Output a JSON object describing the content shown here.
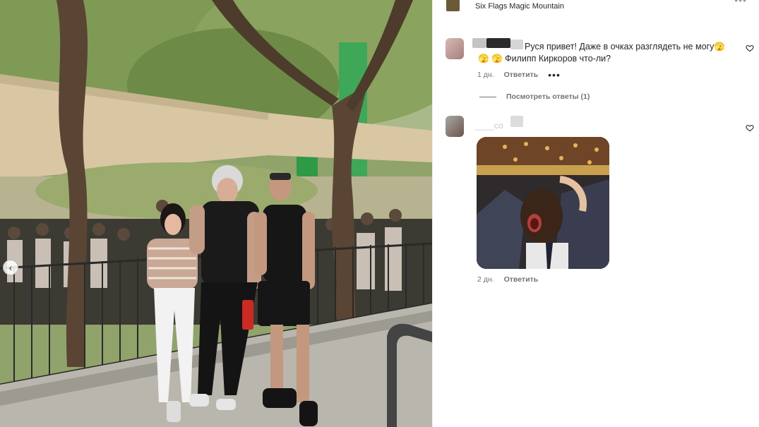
{
  "post": {
    "location": "Six Flags Magic Mountain",
    "more_icon": "more-horizontal-icon"
  },
  "carousel": {
    "prev_icon": "chevron-left-icon",
    "prev_glyph": "‹"
  },
  "comments": [
    {
      "text_line1": "Руся привет! Даже в очках разглядеть не могу🫣",
      "text_line2": "🫣 🫣 Филипп Киркоров что-ли?",
      "time": "1 дн.",
      "reply_label": "Ответить",
      "more_glyph": "•••",
      "view_replies": "Посмотреть ответы (1)"
    },
    {
      "faded_username": "____со",
      "time": "2 дн.",
      "reply_label": "Ответить",
      "media": "gif"
    }
  ],
  "colors": {
    "text": "#262626",
    "secondary": "#737373",
    "border": "#efefef"
  }
}
